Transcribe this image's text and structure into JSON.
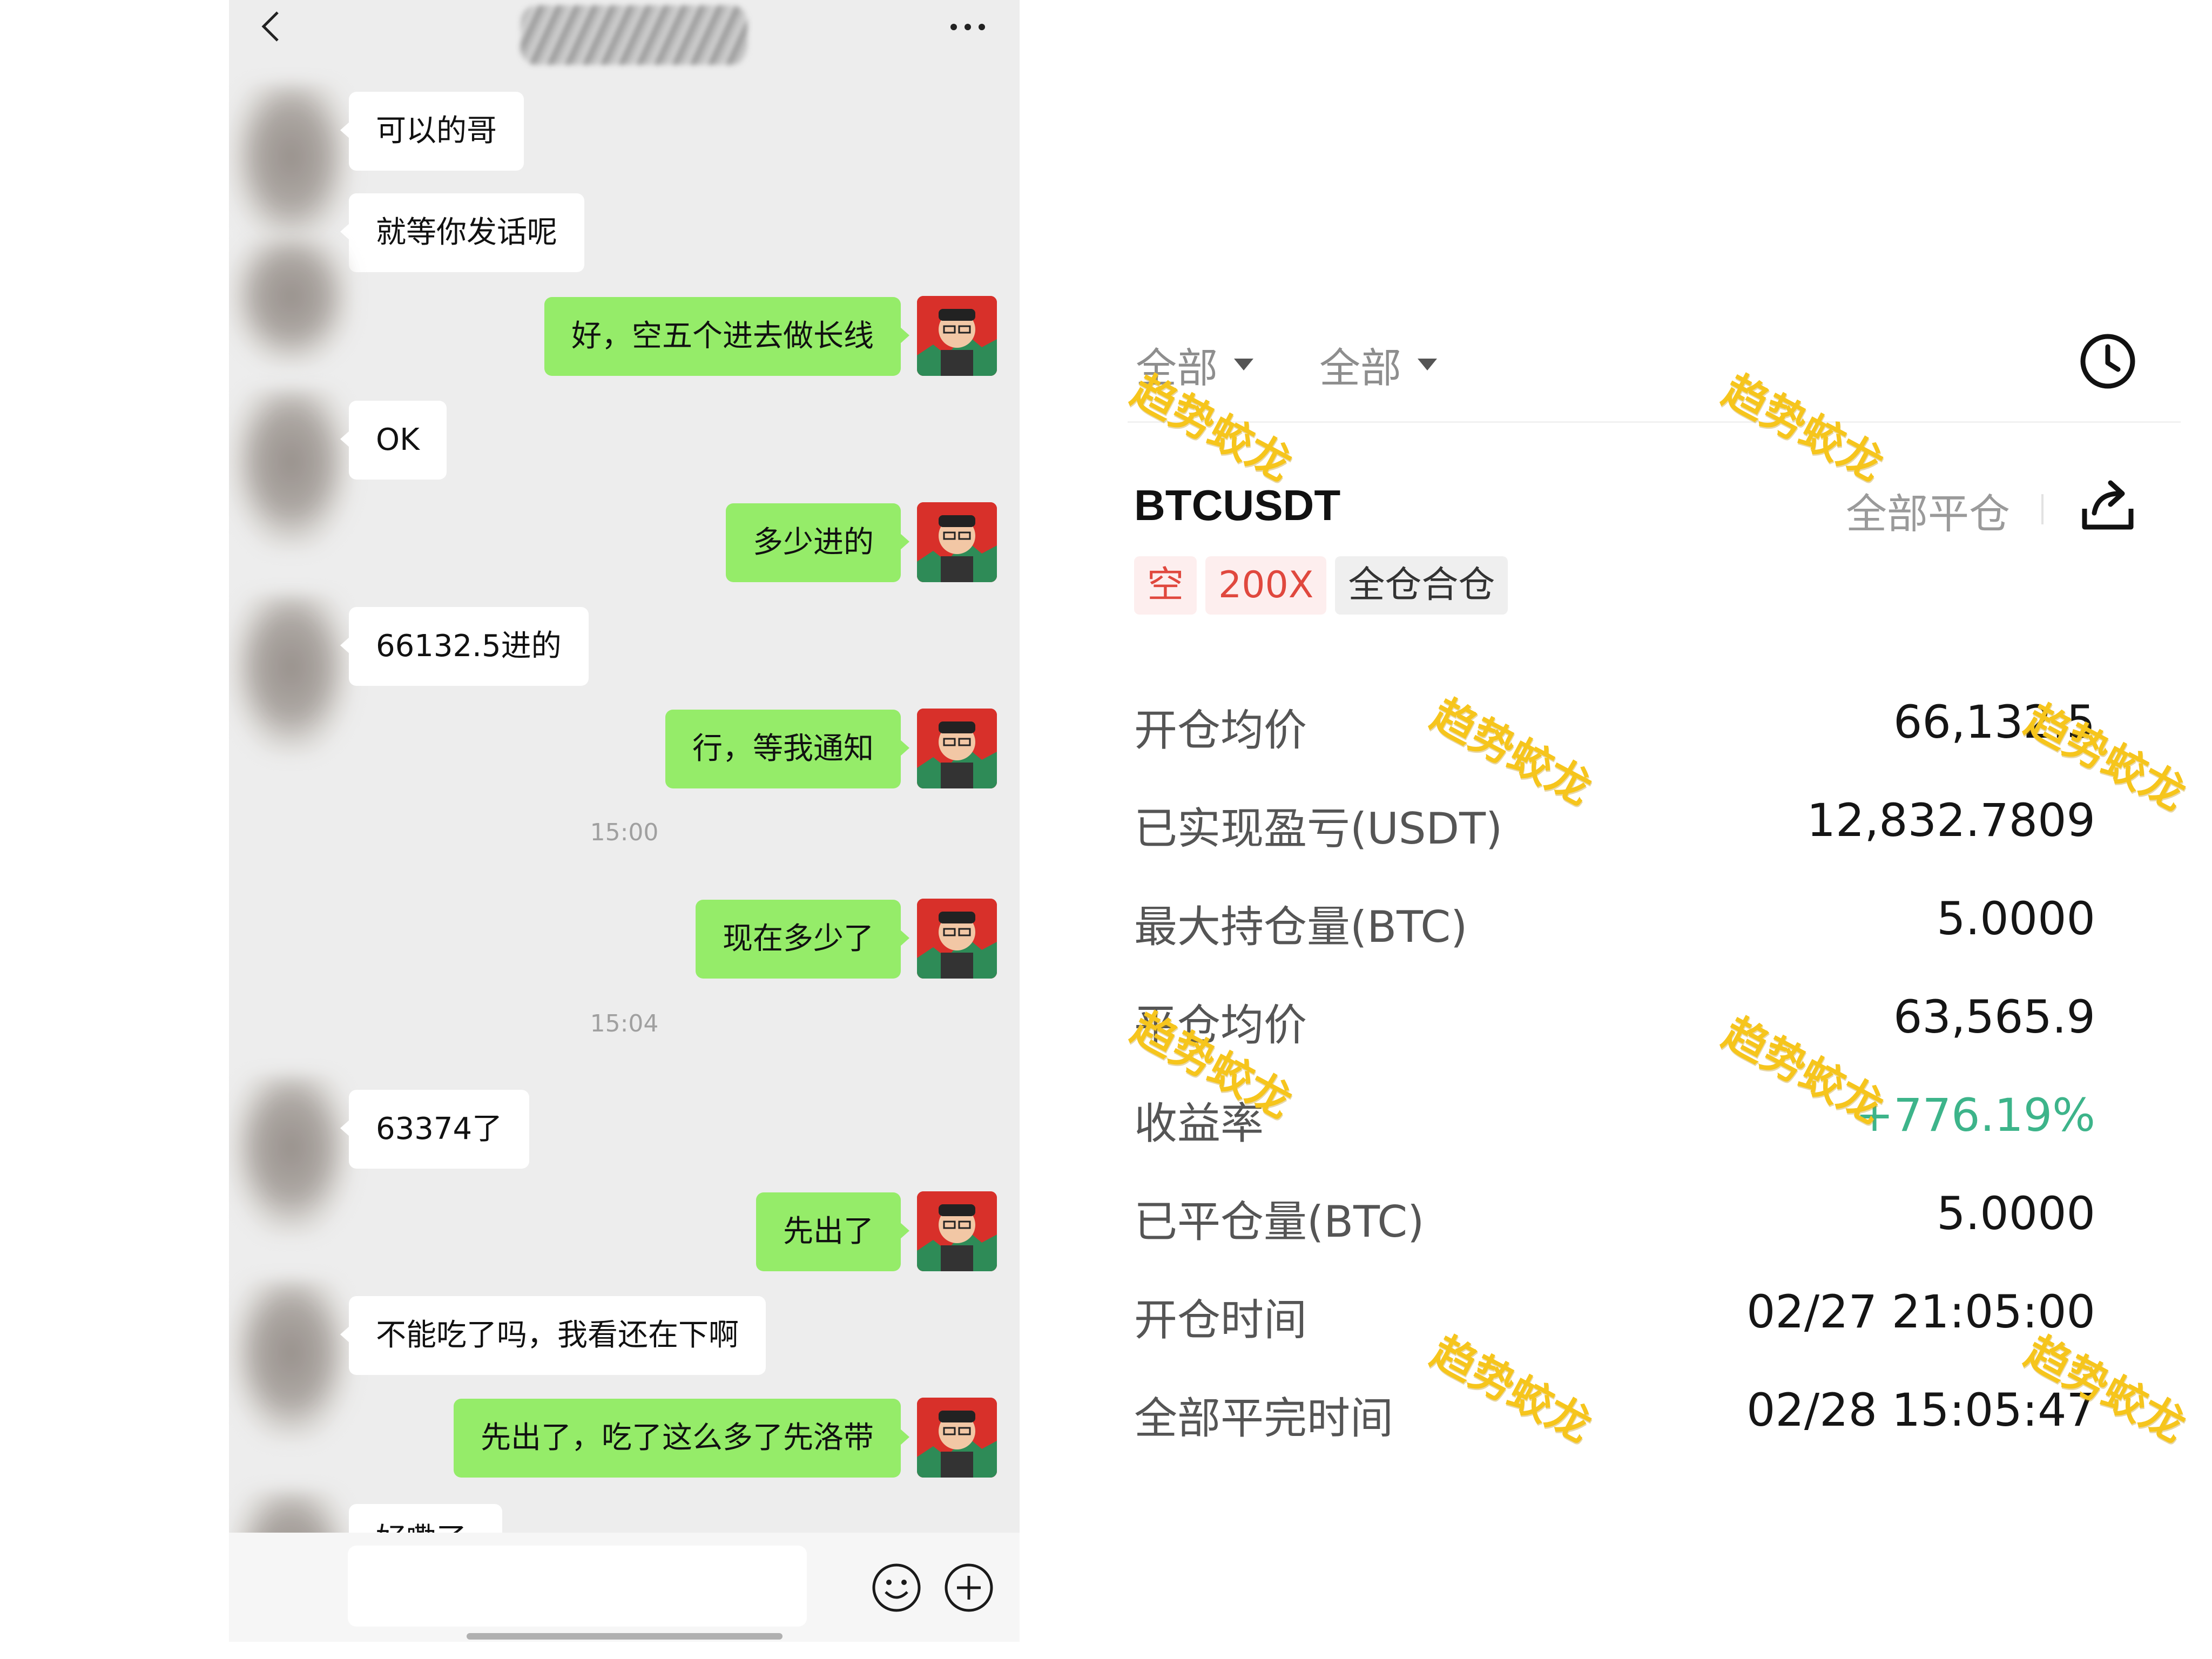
{
  "chat": {
    "title": "",
    "messages": [
      {
        "side": "left",
        "text": "可以的哥"
      },
      {
        "side": "left",
        "text": "就等你发话呢"
      },
      {
        "side": "right",
        "text": "好，空五个进去做长线"
      },
      {
        "side": "left",
        "text": "OK"
      },
      {
        "side": "right",
        "text": "多少进的"
      },
      {
        "side": "left",
        "text": "66132.5进的"
      },
      {
        "side": "right",
        "text": "行，等我通知"
      },
      {
        "type": "time",
        "text": "15:00"
      },
      {
        "side": "right",
        "text": "现在多少了"
      },
      {
        "type": "time",
        "text": "15:04"
      },
      {
        "side": "left",
        "text": "63374了"
      },
      {
        "side": "right",
        "text": "先出了"
      },
      {
        "side": "left",
        "text": "不能吃了吗，我看还在下啊"
      },
      {
        "side": "right",
        "text": "先出了，吃了这么多了先洛带"
      }
    ],
    "partial_message": "好嘞了",
    "icons": {
      "back": "chevron-left-icon",
      "more": "more-dots-icon",
      "emoji": "emoji-icon",
      "plus": "plus-circle-icon"
    }
  },
  "trade": {
    "filters": [
      {
        "label": "全部"
      },
      {
        "label": "全部"
      }
    ],
    "symbol": "BTCUSDT",
    "close_all_label": "全部平仓",
    "tags": [
      {
        "label": "空",
        "style": "red"
      },
      {
        "label": "200X",
        "style": "red"
      },
      {
        "label": "全仓合仓",
        "style": "gray"
      }
    ],
    "details": [
      {
        "label": "开仓均价",
        "value": "66,132.5"
      },
      {
        "label": "已实现盈亏(USDT)",
        "value": "12,832.7809"
      },
      {
        "label": "最大持仓量(BTC)",
        "value": "5.0000"
      },
      {
        "label": "平仓均价",
        "value": "63,565.9"
      },
      {
        "label": "收益率",
        "value": "+776.19%"
      },
      {
        "label": "已平仓量(BTC)",
        "value": "5.0000"
      },
      {
        "label": "开仓时间",
        "value": "02/27 21:05:00"
      },
      {
        "label": "全部平完时间",
        "value": "02/28 15:05:47"
      }
    ],
    "colors": {
      "profit_green": "#3db48a",
      "tag_red": "#e0483e",
      "bubble_green": "#95ec69",
      "watermark": "#f6c51c"
    },
    "watermark_text": "趋势蛟龙"
  }
}
